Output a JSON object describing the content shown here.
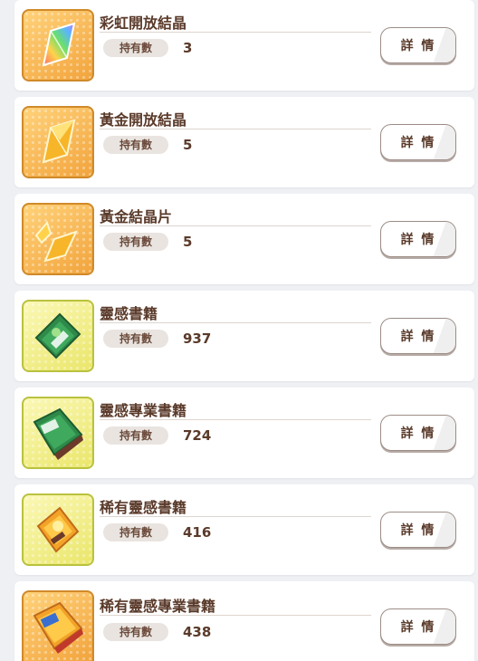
{
  "items": [
    {
      "name": "彩虹開放結晶",
      "holding_label": "持有數",
      "count": "3",
      "detail_label": "詳 情",
      "icon": "rainbow-crystal-icon",
      "frame": "gold"
    },
    {
      "name": "黃金開放結晶",
      "holding_label": "持有數",
      "count": "5",
      "detail_label": "詳 情",
      "icon": "gold-crystal-icon",
      "frame": "gold"
    },
    {
      "name": "黃金結晶片",
      "holding_label": "持有數",
      "count": "5",
      "detail_label": "詳 情",
      "icon": "gold-crystal-shard-icon",
      "frame": "gold"
    },
    {
      "name": "靈感書籍",
      "holding_label": "持有數",
      "count": "937",
      "detail_label": "詳 情",
      "icon": "green-book-icon",
      "frame": "yellow"
    },
    {
      "name": "靈感專業書籍",
      "holding_label": "持有數",
      "count": "724",
      "detail_label": "詳 情",
      "icon": "green-pro-book-icon",
      "frame": "yellow"
    },
    {
      "name": "稀有靈感書籍",
      "holding_label": "持有數",
      "count": "416",
      "detail_label": "詳 情",
      "icon": "gold-book-icon",
      "frame": "yellow"
    },
    {
      "name": "稀有靈感專業書籍",
      "holding_label": "持有數",
      "count": "438",
      "detail_label": "詳 情",
      "icon": "gold-pro-book-icon",
      "frame": "gold"
    }
  ]
}
